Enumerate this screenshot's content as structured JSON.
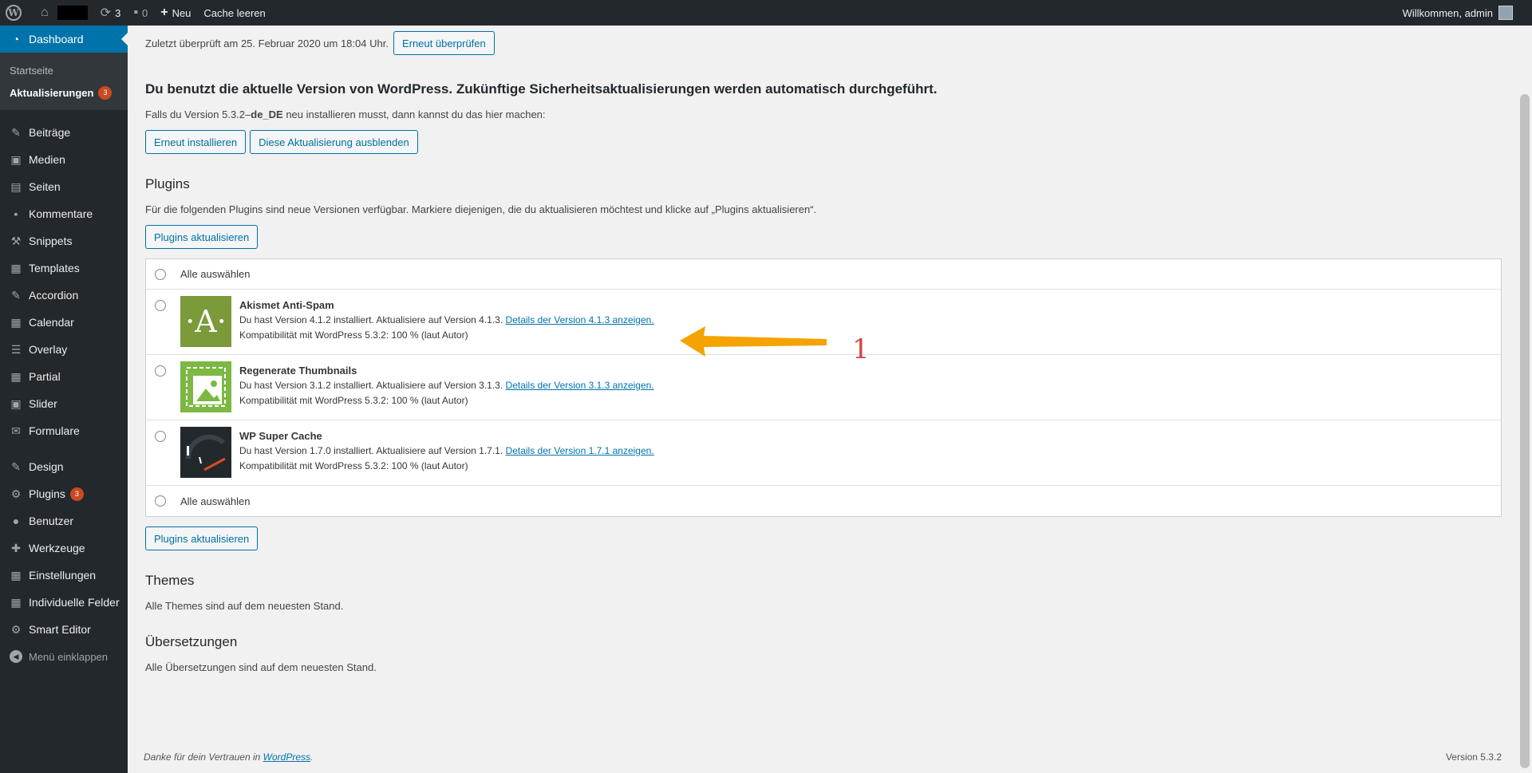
{
  "adminbar": {
    "updates_count": "3",
    "comments_count": "0",
    "new_label": "Neu",
    "cache_label": "Cache leeren",
    "welcome": "Willkommen, admin"
  },
  "sidebar": {
    "dashboard": "Dashboard",
    "submenu": [
      {
        "label": "Startseite"
      },
      {
        "label": "Aktualisierungen",
        "badge": "3"
      }
    ],
    "items": [
      {
        "label": "Beiträge",
        "icon": "pin-icon"
      },
      {
        "label": "Medien",
        "icon": "media-icon"
      },
      {
        "label": "Seiten",
        "icon": "page-icon"
      },
      {
        "label": "Kommentare",
        "icon": "comment-icon"
      },
      {
        "label": "Snippets",
        "icon": "hammer-icon"
      },
      {
        "label": "Templates",
        "icon": "table-icon"
      },
      {
        "label": "Accordion",
        "icon": "pin-icon"
      },
      {
        "label": "Calendar",
        "icon": "calendar-icon"
      },
      {
        "label": "Overlay",
        "icon": "list-icon"
      },
      {
        "label": "Partial",
        "icon": "table-icon"
      },
      {
        "label": "Slider",
        "icon": "gallery-icon"
      },
      {
        "label": "Formulare",
        "icon": "mail-icon"
      },
      {
        "label": "Design",
        "icon": "brush-icon"
      },
      {
        "label": "Plugins",
        "icon": "plugin-icon",
        "badge": "3"
      },
      {
        "label": "Benutzer",
        "icon": "user-icon"
      },
      {
        "label": "Werkzeuge",
        "icon": "wrench-icon"
      },
      {
        "label": "Einstellungen",
        "icon": "settings-icon"
      },
      {
        "label": "Individuelle Felder",
        "icon": "table-icon"
      },
      {
        "label": "Smart Editor",
        "icon": "gear-icon"
      }
    ],
    "collapse": "Menü einklappen"
  },
  "main": {
    "last_checked": "Zuletzt überprüft am 25. Februar 2020 um 18:04 Uhr.",
    "check_again": "Erneut überprüfen",
    "current_version_heading": "Du benutzt die aktuelle Version von WordPress. Zukünftige Sicherheitsaktualisierungen werden automatisch durchgeführt.",
    "reinstall_prefix": "Falls du Version 5.3.2–",
    "reinstall_locale": "de_DE",
    "reinstall_suffix": " neu installieren musst, dann kannst du das hier machen:",
    "reinstall_button": "Erneut installieren",
    "hide_update_button": "Diese Aktualisierung ausblenden",
    "plugins_heading": "Plugins",
    "plugins_intro": "Für die folgenden Plugins sind neue Versionen verfügbar. Markiere diejenigen, die du aktualisieren möchtest und klicke auf „Plugins aktualisieren“.",
    "update_plugins_button": "Plugins aktualisieren",
    "select_all": "Alle auswählen",
    "plugins": [
      {
        "name": "Akismet Anti-Spam",
        "info": "Du hast Version 4.1.2 installiert. Aktualisiere auf Version 4.1.3. ",
        "link": "Details der Version 4.1.3 anzeigen.",
        "compat": "Kompatibilität mit WordPress 5.3.2: 100 % (laut Autor)"
      },
      {
        "name": "Regenerate Thumbnails",
        "info": "Du hast Version 3.1.2 installiert. Aktualisiere auf Version 3.1.3. ",
        "link": "Details der Version 3.1.3 anzeigen.",
        "compat": "Kompatibilität mit WordPress 5.3.2: 100 % (laut Autor)"
      },
      {
        "name": "WP Super Cache",
        "info": "Du hast Version 1.7.0 installiert. Aktualisiere auf Version 1.7.1. ",
        "link": "Details der Version 1.7.1 anzeigen.",
        "compat": "Kompatibilität mit WordPress 5.3.2: 100 % (laut Autor)"
      }
    ],
    "themes_heading": "Themes",
    "themes_text": "Alle Themes sind auf dem neuesten Stand.",
    "translations_heading": "Übersetzungen",
    "translations_text": "Alle Übersetzungen sind auf dem neuesten Stand."
  },
  "footer": {
    "thanks_prefix": "Danke für dein Vertrauen in ",
    "thanks_link": "WordPress",
    "thanks_suffix": ".",
    "version": "Version 5.3.2"
  },
  "annotation": {
    "number": "1",
    "color": "#f4a300"
  },
  "colors": {
    "accent": "#0073aa",
    "sidebar": "#23282d",
    "badge": "#ca4a1f"
  }
}
